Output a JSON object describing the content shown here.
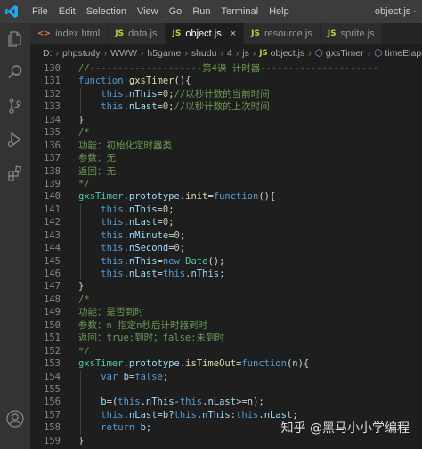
{
  "window": {
    "title": "object.js -",
    "menu": [
      "File",
      "Edit",
      "Selection",
      "View",
      "Go",
      "Run",
      "Terminal",
      "Help"
    ]
  },
  "activity_bar": [
    "files-icon",
    "search-icon",
    "source-control-icon",
    "run-debug-icon",
    "extensions-icon",
    "account-icon"
  ],
  "tabs": [
    {
      "type": "html",
      "icon_text": "<>",
      "label": "index.html",
      "active": false
    },
    {
      "type": "js",
      "icon_text": "JS",
      "label": "data.js",
      "active": false
    },
    {
      "type": "js",
      "icon_text": "JS",
      "label": "object.js",
      "active": true,
      "close": "×"
    },
    {
      "type": "js",
      "icon_text": "JS",
      "label": "resource.js",
      "active": false
    },
    {
      "type": "js",
      "icon_text": "JS",
      "label": "sprite.js",
      "active": false
    }
  ],
  "breadcrumb": {
    "parts": [
      "D:",
      "phpstudy",
      "WWW",
      "h5game",
      "shudu",
      "4",
      "js"
    ],
    "file_icon": "JS",
    "file": "object.js",
    "fn1": "gxsTimer",
    "fn2": "timeElaps"
  },
  "code": [
    {
      "n": "130",
      "indent": 0,
      "t": [
        [
          "cm",
          "//--------------------第4课 计时器---------------------"
        ]
      ]
    },
    {
      "n": "131",
      "indent": 0,
      "t": [
        [
          "kw",
          "function "
        ],
        [
          "fn",
          "gxsTimer"
        ],
        [
          "pl",
          "(){"
        ]
      ]
    },
    {
      "n": "132",
      "indent": 1,
      "t": [
        [
          "kw",
          "this"
        ],
        [
          "pl",
          "."
        ],
        [
          "va",
          "nThis"
        ],
        [
          "pl",
          "="
        ],
        [
          "nu",
          "0"
        ],
        [
          "pl",
          ";"
        ],
        [
          "cm",
          "//以秒计数的当前时间"
        ]
      ]
    },
    {
      "n": "133",
      "indent": 1,
      "t": [
        [
          "kw",
          "this"
        ],
        [
          "pl",
          "."
        ],
        [
          "va",
          "nLast"
        ],
        [
          "pl",
          "="
        ],
        [
          "nu",
          "0"
        ],
        [
          "pl",
          ";"
        ],
        [
          "cm",
          "//以秒计数的上次时间"
        ]
      ]
    },
    {
      "n": "134",
      "indent": 0,
      "t": [
        [
          "pl",
          "}"
        ]
      ]
    },
    {
      "n": "135",
      "indent": 0,
      "t": [
        [
          "cm",
          "/*"
        ]
      ]
    },
    {
      "n": "136",
      "indent": 0,
      "t": [
        [
          "cm",
          "功能：初始化定时器类"
        ]
      ]
    },
    {
      "n": "137",
      "indent": 0,
      "t": [
        [
          "cm",
          "参数：无"
        ]
      ]
    },
    {
      "n": "138",
      "indent": 0,
      "t": [
        [
          "cm",
          "返回：无"
        ]
      ]
    },
    {
      "n": "139",
      "indent": 0,
      "t": [
        [
          "cm",
          "*/"
        ]
      ]
    },
    {
      "n": "140",
      "indent": 0,
      "t": [
        [
          "cl",
          "gxsTimer"
        ],
        [
          "pl",
          "."
        ],
        [
          "va",
          "prototype"
        ],
        [
          "pl",
          "."
        ],
        [
          "fn",
          "init"
        ],
        [
          "pl",
          "="
        ],
        [
          "kw",
          "function"
        ],
        [
          "pl",
          "(){"
        ]
      ]
    },
    {
      "n": "141",
      "indent": 1,
      "t": [
        [
          "kw",
          "this"
        ],
        [
          "pl",
          "."
        ],
        [
          "va",
          "nThis"
        ],
        [
          "pl",
          "="
        ],
        [
          "nu",
          "0"
        ],
        [
          "pl",
          ";"
        ]
      ]
    },
    {
      "n": "142",
      "indent": 1,
      "t": [
        [
          "kw",
          "this"
        ],
        [
          "pl",
          "."
        ],
        [
          "va",
          "nLast"
        ],
        [
          "pl",
          "="
        ],
        [
          "nu",
          "0"
        ],
        [
          "pl",
          ";"
        ]
      ]
    },
    {
      "n": "143",
      "indent": 1,
      "t": [
        [
          "kw",
          "this"
        ],
        [
          "pl",
          "."
        ],
        [
          "va",
          "nMinute"
        ],
        [
          "pl",
          "="
        ],
        [
          "nu",
          "0"
        ],
        [
          "pl",
          ";"
        ]
      ]
    },
    {
      "n": "144",
      "indent": 1,
      "t": [
        [
          "kw",
          "this"
        ],
        [
          "pl",
          "."
        ],
        [
          "va",
          "nSecond"
        ],
        [
          "pl",
          "="
        ],
        [
          "nu",
          "0"
        ],
        [
          "pl",
          ";"
        ]
      ]
    },
    {
      "n": "145",
      "indent": 1,
      "t": [
        [
          "kw",
          "this"
        ],
        [
          "pl",
          "."
        ],
        [
          "va",
          "nThis"
        ],
        [
          "pl",
          "="
        ],
        [
          "kw",
          "new "
        ],
        [
          "cl",
          "Date"
        ],
        [
          "pl",
          "();"
        ]
      ]
    },
    {
      "n": "146",
      "indent": 1,
      "t": [
        [
          "kw",
          "this"
        ],
        [
          "pl",
          "."
        ],
        [
          "va",
          "nLast"
        ],
        [
          "pl",
          "="
        ],
        [
          "kw",
          "this"
        ],
        [
          "pl",
          "."
        ],
        [
          "va",
          "nThis"
        ],
        [
          "pl",
          ";"
        ]
      ]
    },
    {
      "n": "147",
      "indent": 0,
      "t": [
        [
          "pl",
          "}"
        ]
      ]
    },
    {
      "n": "148",
      "indent": 0,
      "t": [
        [
          "cm",
          "/*"
        ]
      ]
    },
    {
      "n": "149",
      "indent": 0,
      "t": [
        [
          "cm",
          "功能：是否到时"
        ]
      ]
    },
    {
      "n": "150",
      "indent": 0,
      "t": [
        [
          "cm",
          "参数：n 指定n秒后计时器到时"
        ]
      ]
    },
    {
      "n": "151",
      "indent": 0,
      "t": [
        [
          "cm",
          "返回：true:到时；false:未到时"
        ]
      ]
    },
    {
      "n": "152",
      "indent": 0,
      "t": [
        [
          "cm",
          "*/"
        ]
      ]
    },
    {
      "n": "153",
      "indent": 0,
      "t": [
        [
          "cl",
          "gxsTimer"
        ],
        [
          "pl",
          "."
        ],
        [
          "va",
          "prototype"
        ],
        [
          "pl",
          "."
        ],
        [
          "fn",
          "isTimeOut"
        ],
        [
          "pl",
          "="
        ],
        [
          "kw",
          "function"
        ],
        [
          "pl",
          "("
        ],
        [
          "va",
          "n"
        ],
        [
          "pl",
          "){"
        ]
      ]
    },
    {
      "n": "154",
      "indent": 1,
      "t": [
        [
          "kw",
          "var "
        ],
        [
          "va",
          "b"
        ],
        [
          "pl",
          "="
        ],
        [
          "kw",
          "false"
        ],
        [
          "pl",
          ";"
        ]
      ]
    },
    {
      "n": "155",
      "indent": 1,
      "t": []
    },
    {
      "n": "156",
      "indent": 1,
      "t": [
        [
          "va",
          "b"
        ],
        [
          "pl",
          "=("
        ],
        [
          "kw",
          "this"
        ],
        [
          "pl",
          "."
        ],
        [
          "va",
          "nThis"
        ],
        [
          "pl",
          "-"
        ],
        [
          "kw",
          "this"
        ],
        [
          "pl",
          "."
        ],
        [
          "va",
          "nLast"
        ],
        [
          "pl",
          ">="
        ],
        [
          "va",
          "n"
        ],
        [
          "pl",
          ");"
        ]
      ]
    },
    {
      "n": "157",
      "indent": 1,
      "t": [
        [
          "kw",
          "this"
        ],
        [
          "pl",
          "."
        ],
        [
          "va",
          "nLast"
        ],
        [
          "pl",
          "="
        ],
        [
          "va",
          "b"
        ],
        [
          "pl",
          "?"
        ],
        [
          "kw",
          "this"
        ],
        [
          "pl",
          "."
        ],
        [
          "va",
          "nThis"
        ],
        [
          "pl",
          ":"
        ],
        [
          "kw",
          "this"
        ],
        [
          "pl",
          "."
        ],
        [
          "va",
          "nLast"
        ],
        [
          "pl",
          ";"
        ]
      ]
    },
    {
      "n": "158",
      "indent": 1,
      "t": [
        [
          "kw",
          "return "
        ],
        [
          "va",
          "b"
        ],
        [
          "pl",
          ";"
        ]
      ]
    },
    {
      "n": "159",
      "indent": 0,
      "t": [
        [
          "pl",
          "}"
        ]
      ]
    }
  ],
  "watermark": "知乎 @黑马小小学编程"
}
